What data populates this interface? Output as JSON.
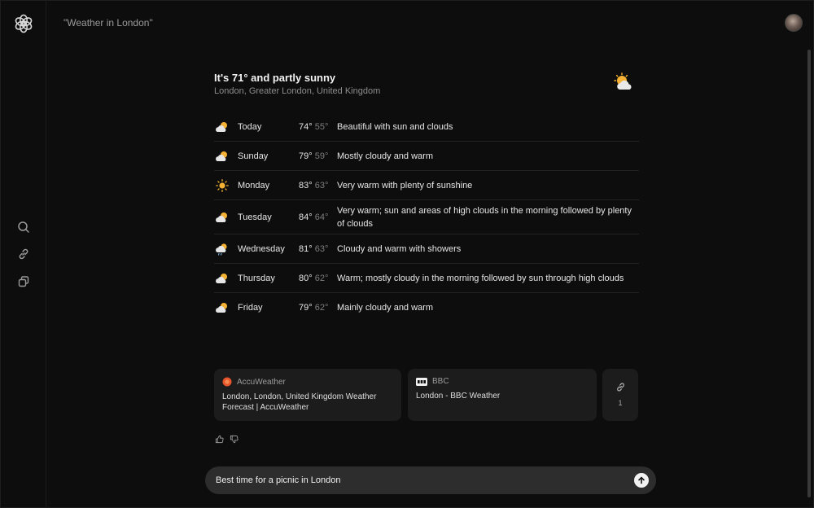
{
  "topbar": {
    "query": "\"Weather in London\""
  },
  "weather": {
    "headline": "It's 71° and partly sunny",
    "location": "London, Greater London, United Kingdom",
    "forecast": [
      {
        "day": "Today",
        "hi": "74°",
        "lo": "55°",
        "desc": "Beautiful with sun and clouds",
        "icon": "partly-cloudy-icon"
      },
      {
        "day": "Sunday",
        "hi": "79°",
        "lo": "59°",
        "desc": "Mostly cloudy and warm",
        "icon": "partly-cloudy-icon"
      },
      {
        "day": "Monday",
        "hi": "83°",
        "lo": "63°",
        "desc": "Very warm with plenty of sunshine",
        "icon": "sun-icon"
      },
      {
        "day": "Tuesday",
        "hi": "84°",
        "lo": "64°",
        "desc": "Very warm; sun and areas of high clouds in the morning followed by plenty of clouds",
        "icon": "partly-cloudy-icon"
      },
      {
        "day": "Wednesday",
        "hi": "81°",
        "lo": "63°",
        "desc": "Cloudy and warm with showers",
        "icon": "rain-cloud-icon"
      },
      {
        "day": "Thursday",
        "hi": "80°",
        "lo": "62°",
        "desc": "Warm; mostly cloudy in the morning followed by sun through high clouds",
        "icon": "partly-cloudy-icon"
      },
      {
        "day": "Friday",
        "hi": "79°",
        "lo": "62°",
        "desc": "Mainly cloudy and warm",
        "icon": "partly-cloudy-icon"
      }
    ]
  },
  "sources": [
    {
      "site": "AccuWeather",
      "title": "London, London, United Kingdom Weather Forecast | AccuWeather",
      "icon": "accuweather-logo-icon",
      "color": "#e8542b"
    },
    {
      "site": "BBC",
      "title": "London - BBC Weather",
      "icon": "bbc-logo-icon",
      "color": "#ffffff"
    }
  ],
  "sources_more": {
    "count": "1"
  },
  "composer": {
    "value": "Best time for a picnic in London"
  },
  "colors": {
    "background": "#0d0d0d",
    "card": "#1c1c1c",
    "composer": "#2d2d2d"
  }
}
